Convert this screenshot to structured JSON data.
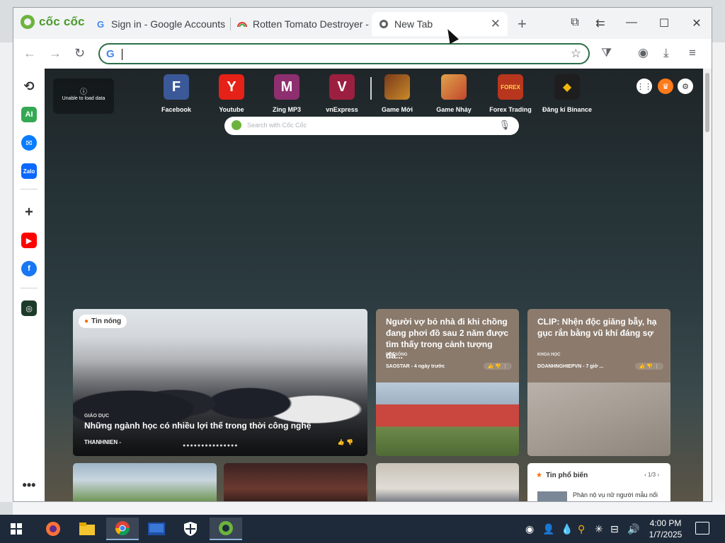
{
  "browser": {
    "brand": "cốc cốc",
    "tabs": [
      {
        "title": "Sign in - Google Accounts",
        "icon": "google-icon"
      },
      {
        "title": "Rotten Tomato Destroyer -",
        "icon": "rainbow-icon"
      },
      {
        "title": "New Tab",
        "icon": "coccoc-icon",
        "active": true
      }
    ],
    "omnibox": {
      "value": "",
      "placeholder": ""
    }
  },
  "newtab": {
    "unable_text": "Unable to load data",
    "speed_dials": [
      {
        "label": "Facebook",
        "letter": "F",
        "color": "#3b5998"
      },
      {
        "label": "Youtube",
        "letter": "Y",
        "color": "#e62117"
      },
      {
        "label": "Zing MP3",
        "letter": "M",
        "color": "#8e2f6f"
      },
      {
        "label": "vnExpress",
        "letter": "V",
        "color": "#9c1f3f"
      },
      {
        "label": "Game Mới",
        "letter": "",
        "color": "#7a3a1a"
      },
      {
        "label": "Game Nhảy",
        "letter": "",
        "color": "#d98d3b"
      },
      {
        "label": "Forex Trading",
        "letter": "FOREX",
        "color": "#b8361e"
      },
      {
        "label": "Đăng kí Binance",
        "letter": "",
        "color": "#1e1e1e"
      }
    ],
    "search_placeholder": "Search with Cốc Cốc",
    "hot_tag": "Tin nóng",
    "hero": {
      "category": "GIÁO DỤC",
      "title": "Những ngành học có nhiều lợi thế trong thời công nghệ",
      "source": "THANHNIEN -"
    },
    "cards": [
      {
        "title": "Người vợ bỏ nhà đi khi chồng đang phơi đồ sau 2 năm được tìm thấy trong cảnh tượng đá...",
        "category": "ĐỜI SỐNG",
        "source": "SAOSTAR - 4 ngày trước"
      },
      {
        "title": "CLIP: Nhện độc giăng bẫy, hạ gục rắn bằng vũ khí đáng sợ",
        "category": "KHOA HỌC",
        "source": "DOANHNGHIEPVN - 7 giờ ..."
      }
    ],
    "popular": {
      "header": "Tin phổ biến",
      "page": "1/3",
      "item": "Phản nộ vụ nữ người mẫu nổi"
    }
  },
  "taskbar": {
    "time": "4:00 PM",
    "date": "1/7/2025"
  }
}
